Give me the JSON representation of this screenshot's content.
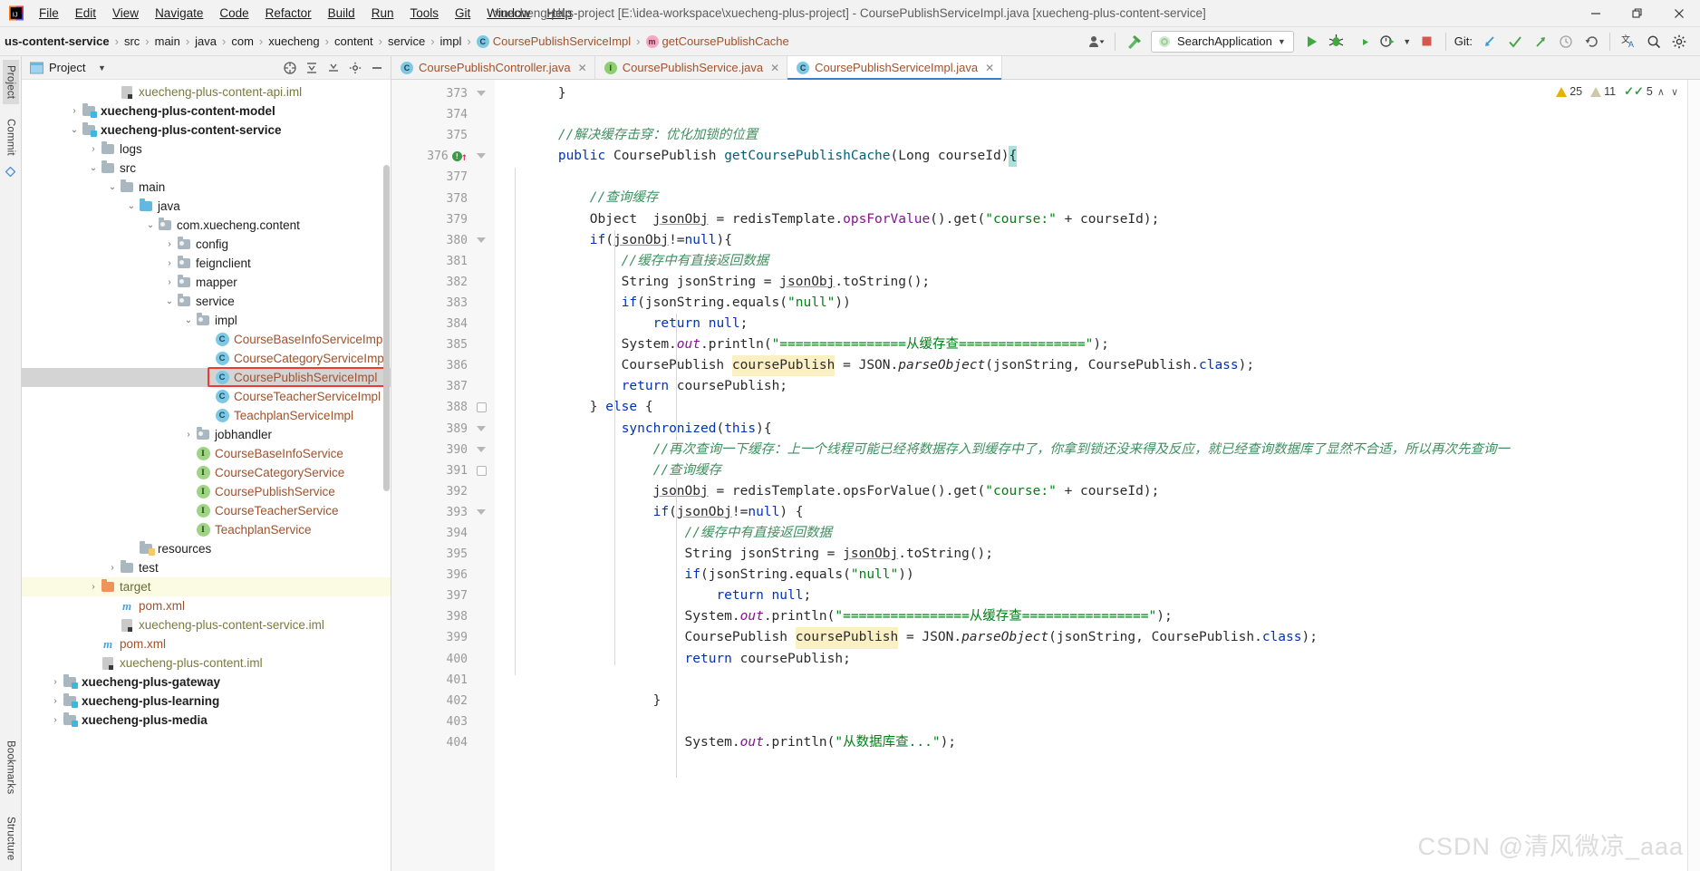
{
  "window": {
    "title": "xuecheng-plus-project [E:\\idea-workspace\\xuecheng-plus-project] - CoursePublishServiceImpl.java [xuecheng-plus-content-service]",
    "minimize": "—",
    "maximize": "❐",
    "close": "✕"
  },
  "menubar": {
    "items": [
      "File",
      "Edit",
      "View",
      "Navigate",
      "Code",
      "Refactor",
      "Build",
      "Run",
      "Tools",
      "Git",
      "Window",
      "Help"
    ]
  },
  "breadcrumbs": {
    "items": [
      {
        "label": "us-content-service",
        "kind": "module"
      },
      {
        "label": "src",
        "kind": "folder"
      },
      {
        "label": "main",
        "kind": "folder"
      },
      {
        "label": "java",
        "kind": "folder"
      },
      {
        "label": "com",
        "kind": "folder"
      },
      {
        "label": "xuecheng",
        "kind": "folder"
      },
      {
        "label": "content",
        "kind": "folder"
      },
      {
        "label": "service",
        "kind": "folder"
      },
      {
        "label": "impl",
        "kind": "folder"
      },
      {
        "label": "CoursePublishServiceImpl",
        "kind": "class",
        "badge": "C"
      },
      {
        "label": "getCoursePublishCache",
        "kind": "method",
        "badge": "m"
      }
    ],
    "separator": "›"
  },
  "toolbar": {
    "run_config": "SearchApplication",
    "git_label": "Git:",
    "icons": {
      "profile": "profile-icon",
      "build": "hammer-icon",
      "run": "run-icon",
      "debug": "debug-icon",
      "coverage": "run-with-coverage-icon",
      "profiler": "profile-run-icon",
      "stop": "stop-icon",
      "update": "git-update-icon",
      "commit": "git-commit-icon",
      "push": "git-push-icon",
      "history": "git-history-icon",
      "rollback": "git-rollback-icon",
      "translate": "translate-icon",
      "search": "search-everywhere-icon",
      "settings": "settings-icon"
    }
  },
  "left_rail": {
    "top": [
      "Project"
    ],
    "side": [
      "Commit"
    ],
    "bottom": [
      "Bookmarks",
      "Structure"
    ]
  },
  "project_panel": {
    "title": "Project",
    "tree": [
      {
        "label": "xuecheng-plus-content-api.iml",
        "indent": 4,
        "twist": "",
        "icon": "iml",
        "style": "t-file"
      },
      {
        "label": "xuecheng-plus-content-model",
        "indent": 2,
        "twist": "›",
        "icon": "module",
        "style": "t-bold"
      },
      {
        "label": "xuecheng-plus-content-service",
        "indent": 2,
        "twist": "⌄",
        "icon": "module",
        "style": "t-bold"
      },
      {
        "label": "logs",
        "indent": 3,
        "twist": "›",
        "icon": "folder",
        "style": "t-plain"
      },
      {
        "label": "src",
        "indent": 3,
        "twist": "⌄",
        "icon": "folder",
        "style": "t-plain"
      },
      {
        "label": "main",
        "indent": 4,
        "twist": "⌄",
        "icon": "folder",
        "style": "t-plain"
      },
      {
        "label": "java",
        "indent": 5,
        "twist": "⌄",
        "icon": "folder-blue",
        "style": "t-plain"
      },
      {
        "label": "com.xuecheng.content",
        "indent": 6,
        "twist": "⌄",
        "icon": "package",
        "style": "t-plain"
      },
      {
        "label": "config",
        "indent": 7,
        "twist": "›",
        "icon": "package",
        "style": "t-plain"
      },
      {
        "label": "feignclient",
        "indent": 7,
        "twist": "›",
        "icon": "package",
        "style": "t-plain"
      },
      {
        "label": "mapper",
        "indent": 7,
        "twist": "›",
        "icon": "package",
        "style": "t-plain"
      },
      {
        "label": "service",
        "indent": 7,
        "twist": "⌄",
        "icon": "package",
        "style": "t-plain"
      },
      {
        "label": "impl",
        "indent": 8,
        "twist": "⌄",
        "icon": "package",
        "style": "t-plain"
      },
      {
        "label": "CourseBaseInfoServiceImpl",
        "indent": 9,
        "twist": "",
        "icon": "class",
        "style": "t-java"
      },
      {
        "label": "CourseCategoryServiceImpl",
        "indent": 9,
        "twist": "",
        "icon": "class",
        "style": "t-java"
      },
      {
        "label": "CoursePublishServiceImpl",
        "indent": 9,
        "twist": "",
        "icon": "class",
        "style": "t-java",
        "selected": true,
        "highlighted_box": true
      },
      {
        "label": "CourseTeacherServiceImpl",
        "indent": 9,
        "twist": "",
        "icon": "class",
        "style": "t-java"
      },
      {
        "label": "TeachplanServiceImpl",
        "indent": 9,
        "twist": "",
        "icon": "class",
        "style": "t-java"
      },
      {
        "label": "jobhandler",
        "indent": 8,
        "twist": "›",
        "icon": "package",
        "style": "t-plain"
      },
      {
        "label": "CourseBaseInfoService",
        "indent": 8,
        "twist": "",
        "icon": "interface",
        "style": "t-java"
      },
      {
        "label": "CourseCategoryService",
        "indent": 8,
        "twist": "",
        "icon": "interface",
        "style": "t-java"
      },
      {
        "label": "CoursePublishService",
        "indent": 8,
        "twist": "",
        "icon": "interface",
        "style": "t-java"
      },
      {
        "label": "CourseTeacherService",
        "indent": 8,
        "twist": "",
        "icon": "interface",
        "style": "t-java"
      },
      {
        "label": "TeachplanService",
        "indent": 8,
        "twist": "",
        "icon": "interface",
        "style": "t-java"
      },
      {
        "label": "resources",
        "indent": 5,
        "twist": "",
        "icon": "resources",
        "style": "t-plain"
      },
      {
        "label": "test",
        "indent": 4,
        "twist": "›",
        "icon": "folder",
        "style": "t-plain"
      },
      {
        "label": "target",
        "indent": 3,
        "twist": "›",
        "icon": "folder-orange",
        "style": "t-target",
        "row_highlight": true
      },
      {
        "label": "pom.xml",
        "indent": 4,
        "twist": "",
        "icon": "pom",
        "style": "t-pom"
      },
      {
        "label": "xuecheng-plus-content-service.iml",
        "indent": 4,
        "twist": "",
        "icon": "iml",
        "style": "t-file"
      },
      {
        "label": "pom.xml",
        "indent": 3,
        "twist": "",
        "icon": "pom",
        "style": "t-pom"
      },
      {
        "label": "xuecheng-plus-content.iml",
        "indent": 3,
        "twist": "",
        "icon": "iml",
        "style": "t-file"
      },
      {
        "label": "xuecheng-plus-gateway",
        "indent": 1,
        "twist": "›",
        "icon": "module",
        "style": "t-bold"
      },
      {
        "label": "xuecheng-plus-learning",
        "indent": 1,
        "twist": "›",
        "icon": "module",
        "style": "t-bold"
      },
      {
        "label": "xuecheng-plus-media",
        "indent": 1,
        "twist": "›",
        "icon": "module",
        "style": "t-bold"
      }
    ]
  },
  "editor": {
    "tabs": [
      {
        "label": "CoursePublishController.java",
        "icon": "class",
        "active": false
      },
      {
        "label": "CoursePublishService.java",
        "icon": "interface",
        "active": false
      },
      {
        "label": "CoursePublishServiceImpl.java",
        "icon": "class",
        "active": true
      }
    ],
    "status": {
      "warnings": "25",
      "weak_warnings": "11",
      "typos": "5",
      "up": "∧",
      "down": "∨"
    },
    "first_line_number": 373,
    "lines": [
      {
        "n": 373,
        "indent": 0,
        "tokens": [
          {
            "t": "        }",
            "c": ""
          }
        ]
      },
      {
        "n": 374,
        "indent": 0,
        "tokens": []
      },
      {
        "n": 375,
        "indent": 0,
        "tokens": [
          {
            "t": "        //解决缓存击穿：优化加锁的位置",
            "c": "cm"
          }
        ]
      },
      {
        "n": 376,
        "indent": 0,
        "breakpoint": true,
        "tokens": [
          {
            "t": "        ",
            "c": ""
          },
          {
            "t": "public",
            "c": "kw"
          },
          {
            "t": " CoursePublish ",
            "c": ""
          },
          {
            "t": "getCoursePublishCache",
            "c": "def"
          },
          {
            "t": "(",
            "c": ""
          },
          {
            "t": "Long courseId",
            "c": ""
          },
          {
            "t": ")",
            "c": ""
          },
          {
            "t": "{",
            "c": "brace-hl"
          }
        ]
      },
      {
        "n": 377,
        "indent": 0,
        "tokens": []
      },
      {
        "n": 378,
        "indent": 0,
        "tokens": [
          {
            "t": "            //查询缓存",
            "c": "cm"
          }
        ]
      },
      {
        "n": 379,
        "indent": 0,
        "tokens": [
          {
            "t": "            Object  ",
            "c": ""
          },
          {
            "t": "jsonObj",
            "c": "ul"
          },
          {
            "t": " = redisTemplate",
            "c": ""
          },
          {
            "t": ".",
            "c": ""
          },
          {
            "t": "opsForValue",
            "c": "fld"
          },
          {
            "t": "().get(",
            "c": ""
          },
          {
            "t": "\"course:\"",
            "c": "str"
          },
          {
            "t": " + courseId);",
            "c": ""
          }
        ]
      },
      {
        "n": 380,
        "indent": 0,
        "tokens": [
          {
            "t": "            ",
            "c": ""
          },
          {
            "t": "if",
            "c": "kw"
          },
          {
            "t": "(",
            "c": ""
          },
          {
            "t": "jsonObj",
            "c": "ul"
          },
          {
            "t": "!=",
            "c": ""
          },
          {
            "t": "null",
            "c": "kw"
          },
          {
            "t": "){",
            "c": ""
          }
        ]
      },
      {
        "n": 381,
        "indent": 0,
        "tokens": [
          {
            "t": "                //缓存中有直接返回数据",
            "c": "cm"
          }
        ]
      },
      {
        "n": 382,
        "indent": 0,
        "tokens": [
          {
            "t": "                String jsonString = ",
            "c": ""
          },
          {
            "t": "jsonObj",
            "c": "ul"
          },
          {
            "t": ".toString();",
            "c": ""
          }
        ]
      },
      {
        "n": 383,
        "indent": 0,
        "tokens": [
          {
            "t": "                ",
            "c": ""
          },
          {
            "t": "if",
            "c": "kw"
          },
          {
            "t": "(jsonString.equals(",
            "c": ""
          },
          {
            "t": "\"null\"",
            "c": "str"
          },
          {
            "t": "))",
            "c": ""
          }
        ]
      },
      {
        "n": 384,
        "indent": 0,
        "tokens": [
          {
            "t": "                    ",
            "c": ""
          },
          {
            "t": "return null",
            "c": "kw"
          },
          {
            "t": ";",
            "c": ""
          }
        ]
      },
      {
        "n": 385,
        "indent": 0,
        "tokens": [
          {
            "t": "                System.",
            "c": ""
          },
          {
            "t": "out",
            "c": "fld italic"
          },
          {
            "t": ".println(",
            "c": ""
          },
          {
            "t": "\"================从缓存查================\"",
            "c": "str"
          },
          {
            "t": ");",
            "c": ""
          }
        ]
      },
      {
        "n": 386,
        "indent": 0,
        "tokens": [
          {
            "t": "                CoursePublish ",
            "c": ""
          },
          {
            "t": "coursePublish",
            "c": "hl"
          },
          {
            "t": " = JSON.",
            "c": ""
          },
          {
            "t": "parseObject",
            "c": "italic"
          },
          {
            "t": "(jsonString, CoursePublish.",
            "c": ""
          },
          {
            "t": "class",
            "c": "kw"
          },
          {
            "t": ");",
            "c": ""
          }
        ]
      },
      {
        "n": 387,
        "indent": 0,
        "tokens": [
          {
            "t": "                ",
            "c": ""
          },
          {
            "t": "return",
            "c": "kw"
          },
          {
            "t": " coursePublish;",
            "c": ""
          }
        ]
      },
      {
        "n": 388,
        "indent": 0,
        "tokens": [
          {
            "t": "            } ",
            "c": ""
          },
          {
            "t": "else",
            "c": "kw"
          },
          {
            "t": " {",
            "c": ""
          }
        ]
      },
      {
        "n": 389,
        "indent": 0,
        "tokens": [
          {
            "t": "                ",
            "c": ""
          },
          {
            "t": "synchronized",
            "c": "kw"
          },
          {
            "t": "(",
            "c": ""
          },
          {
            "t": "this",
            "c": "kw"
          },
          {
            "t": "){",
            "c": ""
          }
        ]
      },
      {
        "n": 390,
        "indent": 0,
        "tokens": [
          {
            "t": "                    //再次查询一下缓存：上一个线程可能已经将数据存入到缓存中了，你拿到锁还没来得及反应，就已经查询数据库了显然不合适，所以再次先查询一",
            "c": "cm"
          }
        ]
      },
      {
        "n": 391,
        "indent": 0,
        "tokens": [
          {
            "t": "                    //查询缓存",
            "c": "cm"
          }
        ]
      },
      {
        "n": 392,
        "indent": 0,
        "tokens": [
          {
            "t": "                    ",
            "c": ""
          },
          {
            "t": "jsonObj",
            "c": "ul"
          },
          {
            "t": " = redisTemplate.opsForValue().get(",
            "c": ""
          },
          {
            "t": "\"course:\"",
            "c": "str"
          },
          {
            "t": " + courseId);",
            "c": ""
          }
        ]
      },
      {
        "n": 393,
        "indent": 0,
        "tokens": [
          {
            "t": "                    ",
            "c": ""
          },
          {
            "t": "if",
            "c": "kw"
          },
          {
            "t": "(",
            "c": ""
          },
          {
            "t": "jsonObj",
            "c": "ul"
          },
          {
            "t": "!=",
            "c": ""
          },
          {
            "t": "null",
            "c": "kw"
          },
          {
            "t": ") {",
            "c": ""
          }
        ]
      },
      {
        "n": 394,
        "indent": 0,
        "tokens": [
          {
            "t": "                        //缓存中有直接返回数据",
            "c": "cm"
          }
        ]
      },
      {
        "n": 395,
        "indent": 0,
        "tokens": [
          {
            "t": "                        String jsonString = ",
            "c": ""
          },
          {
            "t": "jsonObj",
            "c": "ul"
          },
          {
            "t": ".toString();",
            "c": ""
          }
        ]
      },
      {
        "n": 396,
        "indent": 0,
        "tokens": [
          {
            "t": "                        ",
            "c": ""
          },
          {
            "t": "if",
            "c": "kw"
          },
          {
            "t": "(jsonString.equals(",
            "c": ""
          },
          {
            "t": "\"null\"",
            "c": "str"
          },
          {
            "t": "))",
            "c": ""
          }
        ]
      },
      {
        "n": 397,
        "indent": 0,
        "tokens": [
          {
            "t": "                            ",
            "c": ""
          },
          {
            "t": "return null",
            "c": "kw"
          },
          {
            "t": ";",
            "c": ""
          }
        ]
      },
      {
        "n": 398,
        "indent": 0,
        "tokens": [
          {
            "t": "                        System.",
            "c": ""
          },
          {
            "t": "out",
            "c": "fld italic"
          },
          {
            "t": ".println(",
            "c": ""
          },
          {
            "t": "\"================从缓存查================\"",
            "c": "str"
          },
          {
            "t": ");",
            "c": ""
          }
        ]
      },
      {
        "n": 399,
        "indent": 0,
        "tokens": [
          {
            "t": "                        CoursePublish ",
            "c": ""
          },
          {
            "t": "coursePublish",
            "c": "hl"
          },
          {
            "t": " = JSON.",
            "c": ""
          },
          {
            "t": "parseObject",
            "c": "italic"
          },
          {
            "t": "(jsonString, CoursePublish.",
            "c": ""
          },
          {
            "t": "class",
            "c": "kw"
          },
          {
            "t": ");",
            "c": ""
          }
        ]
      },
      {
        "n": 400,
        "indent": 0,
        "tokens": [
          {
            "t": "                        ",
            "c": ""
          },
          {
            "t": "return",
            "c": "kw"
          },
          {
            "t": " coursePublish;",
            "c": ""
          }
        ]
      },
      {
        "n": 401,
        "indent": 0,
        "tokens": []
      },
      {
        "n": 402,
        "indent": 0,
        "tokens": [
          {
            "t": "                    }",
            "c": ""
          }
        ]
      },
      {
        "n": 403,
        "indent": 0,
        "tokens": []
      },
      {
        "n": 404,
        "indent": 0,
        "tokens": [
          {
            "t": "                        System.",
            "c": ""
          },
          {
            "t": "out",
            "c": "fld italic"
          },
          {
            "t": ".println(",
            "c": ""
          },
          {
            "t": "\"从数据库查...\"",
            "c": "str"
          },
          {
            "t": ");",
            "c": ""
          }
        ]
      }
    ]
  },
  "watermark": "CSDN @清风微凉_aaa"
}
